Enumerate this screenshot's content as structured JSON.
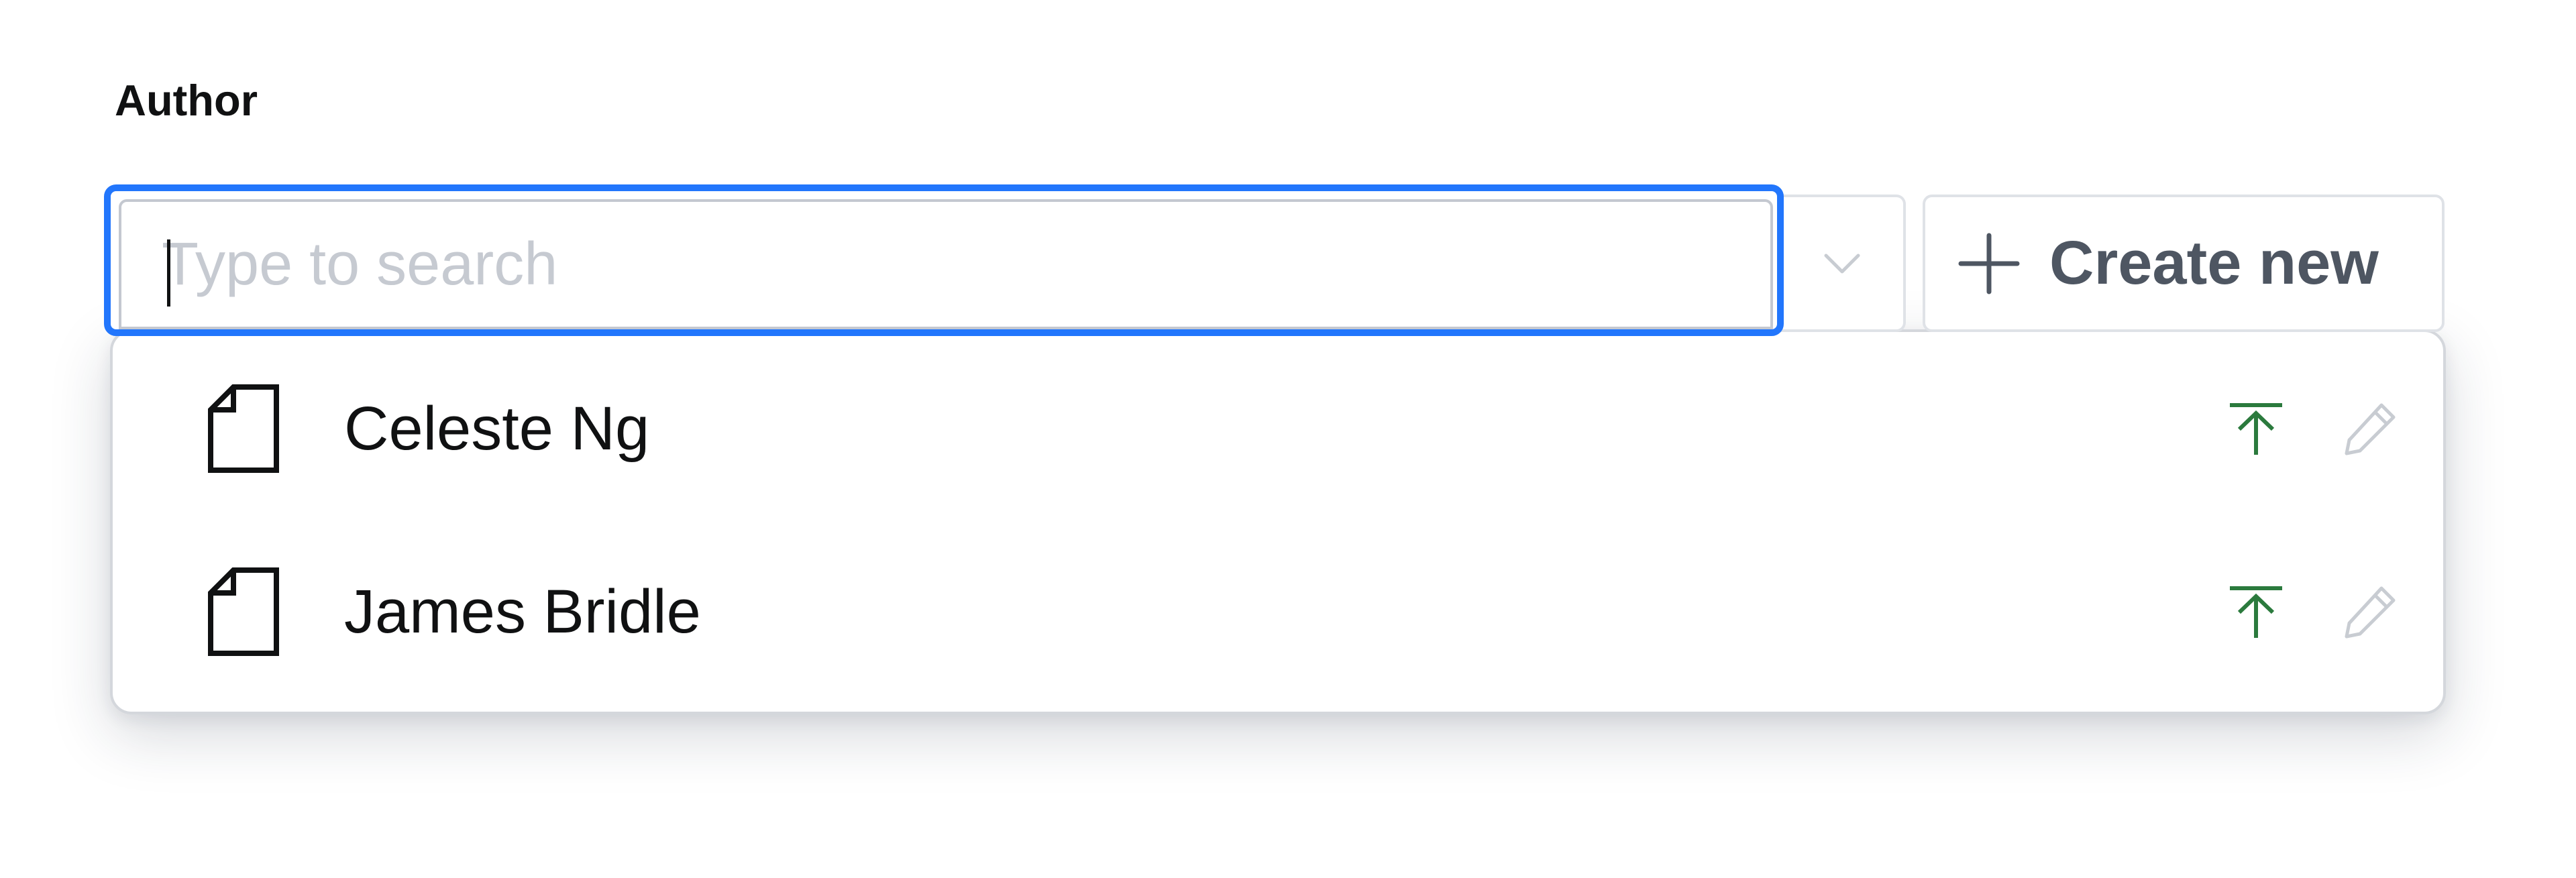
{
  "field": {
    "label": "Author"
  },
  "search": {
    "placeholder": "Type to search",
    "value": ""
  },
  "toggle": {
    "icon": "chevron-down-icon"
  },
  "create": {
    "icon": "plus-icon",
    "label": "Create new"
  },
  "options": [
    {
      "label": "Celeste Ng",
      "icon": "document-icon",
      "status_icon": "publish-icon",
      "action_icon": "edit-icon"
    },
    {
      "label": "James Bridle",
      "icon": "document-icon",
      "status_icon": "publish-icon",
      "action_icon": "edit-icon"
    }
  ],
  "colors": {
    "focus_border": "#2276fc",
    "publish_green": "#2b7a3d",
    "muted_icon": "#c8ccd2",
    "text": "#101112",
    "placeholder": "#c6cad1"
  }
}
